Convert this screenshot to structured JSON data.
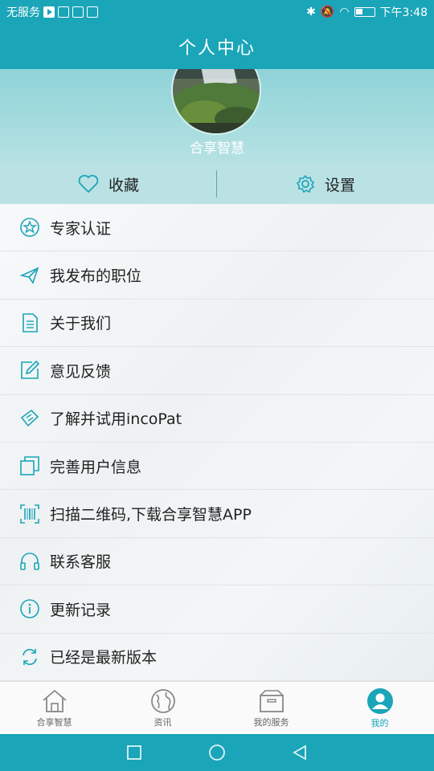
{
  "status_bar": {
    "carrier": "无服务",
    "time": "下午3:48"
  },
  "title": "个人中心",
  "profile": {
    "username": "合享智慧"
  },
  "actions": [
    {
      "label": "收藏",
      "icon": "heart-icon"
    },
    {
      "label": "设置",
      "icon": "gear-icon"
    }
  ],
  "menu": [
    {
      "label": "专家认证",
      "icon": "star-badge-icon"
    },
    {
      "label": "我发布的职位",
      "icon": "send-icon"
    },
    {
      "label": "关于我们",
      "icon": "document-icon"
    },
    {
      "label": "意见反馈",
      "icon": "edit-icon"
    },
    {
      "label": "了解并试用incoPat",
      "icon": "ticket-icon"
    },
    {
      "label": "完善用户信息",
      "icon": "copy-icon"
    },
    {
      "label": "扫描二维码,下载合享智慧APP",
      "icon": "barcode-scan-icon"
    },
    {
      "label": "联系客服",
      "icon": "headset-icon"
    },
    {
      "label": "更新记录",
      "icon": "info-icon"
    },
    {
      "label": "已经是最新版本",
      "icon": "refresh-icon"
    }
  ],
  "tabs": [
    {
      "label": "合享智慧",
      "icon": "home-icon",
      "active": false
    },
    {
      "label": "资讯",
      "icon": "globe-icon",
      "active": false
    },
    {
      "label": "我的服务",
      "icon": "box-icon",
      "active": false
    },
    {
      "label": "我的",
      "icon": "user-icon",
      "active": true
    }
  ],
  "colors": {
    "primary": "#1aa5b8",
    "header_bg": "#a6dcdf",
    "text": "#222222"
  }
}
